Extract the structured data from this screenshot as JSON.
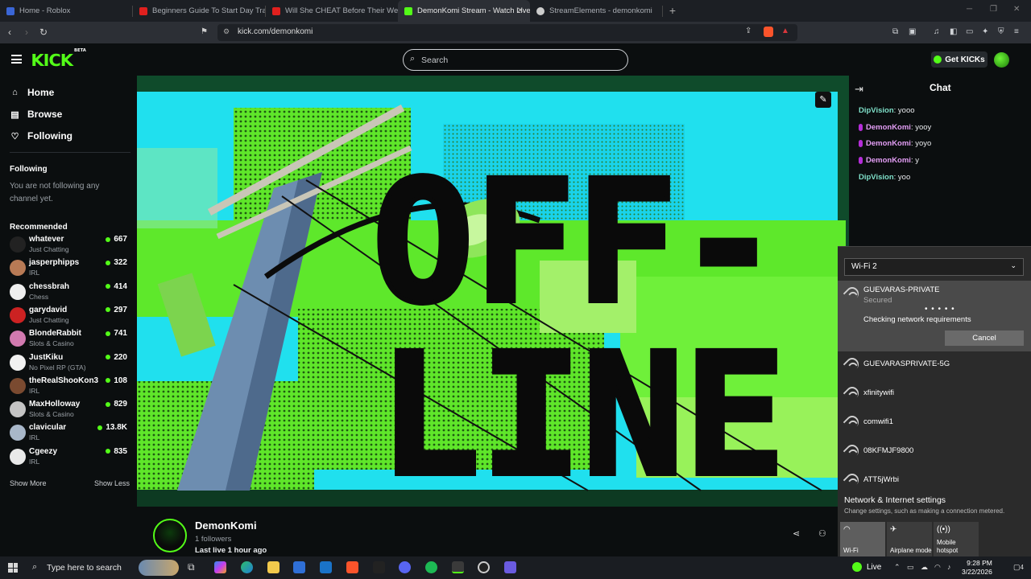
{
  "browser": {
    "tabs": [
      {
        "title": "Home - Roblox",
        "color": "#3a66d6"
      },
      {
        "title": "Beginners Guide To Start Day Trading",
        "color": "#e0201e"
      },
      {
        "title": "Will She CHEAT Before Their Wedding",
        "color": "#e0201e"
      },
      {
        "title": "DemonKomi Stream - Watch Live",
        "color": "#53fc18"
      },
      {
        "title": "StreamElements - demonkomi",
        "color": "#cccccc"
      }
    ],
    "active_tab_index": 3,
    "new_tab_symbol": "+",
    "url": "kick.com/demonkomi"
  },
  "kick": {
    "logo": "KICK",
    "logo_sup": "BETA",
    "search_placeholder": "Search",
    "get_kicks_label": "Get KICKs",
    "accent": "#53fc18"
  },
  "sidebar": {
    "nav": [
      {
        "label": "Home",
        "icon": "home-icon",
        "glyph": "⌂"
      },
      {
        "label": "Browse",
        "icon": "browse-icon",
        "glyph": "▤"
      },
      {
        "label": "Following",
        "icon": "heart-icon",
        "glyph": "♡"
      }
    ],
    "following_heading": "Following",
    "following_empty": "You are not following any channel yet.",
    "recommended_heading": "Recommended",
    "recommended": [
      {
        "name": "whatever",
        "category": "Just Chatting",
        "viewers": "667",
        "avatar": "#222222"
      },
      {
        "name": "jasperphipps",
        "category": "IRL",
        "viewers": "322",
        "avatar": "#b87a55"
      },
      {
        "name": "chessbrah",
        "category": "Chess",
        "viewers": "414",
        "avatar": "#eeeeee"
      },
      {
        "name": "garydavid",
        "category": "Just Chatting",
        "viewers": "297",
        "avatar": "#cc2222"
      },
      {
        "name": "BlondeRabbit",
        "category": "Slots & Casino",
        "viewers": "741",
        "avatar": "#d27ab0"
      },
      {
        "name": "JustKiku",
        "category": "No Pixel RP (GTA)",
        "viewers": "220",
        "avatar": "#f1f1f1"
      },
      {
        "name": "theRealShooKon3",
        "category": "IRL",
        "viewers": "108",
        "avatar": "#7a4a30"
      },
      {
        "name": "MaxHolloway",
        "category": "Slots & Casino",
        "viewers": "829",
        "avatar": "#c4c4c4"
      },
      {
        "name": "clavicular",
        "category": "IRL",
        "viewers": "13.8K",
        "avatar": "#a8b7c9"
      },
      {
        "name": "Cgeezy",
        "category": "IRL",
        "viewers": "835",
        "avatar": "#e9e9e9"
      }
    ],
    "show_more": "Show More",
    "show_less": "Show Less"
  },
  "video": {
    "offline_line1": "OFF-",
    "offline_line2": "LINE"
  },
  "channel": {
    "name": "DemonKomi",
    "followers": "1 followers",
    "last_live": "Last live 1 hour ago"
  },
  "chat": {
    "title": "Chat",
    "messages": [
      {
        "user": "DipVision",
        "text": "yooo",
        "color": "#7fe0c9",
        "badge": false
      },
      {
        "user": "DemonKomi",
        "text": "yooy",
        "color": "#e39ef5",
        "badge": true
      },
      {
        "user": "DemonKomi",
        "text": "yoyo",
        "color": "#e39ef5",
        "badge": true
      },
      {
        "user": "DemonKomi",
        "text": "y",
        "color": "#e39ef5",
        "badge": true
      },
      {
        "user": "DipVision",
        "text": "yoo",
        "color": "#7fe0c9",
        "badge": false
      }
    ]
  },
  "wifi": {
    "adapter": "Wi-Fi 2",
    "connecting": {
      "name": "GUEVARAS-PRIVATE",
      "status": "Secured",
      "progress": "• • • • •",
      "message": "Checking network requirements",
      "cancel": "Cancel"
    },
    "networks": [
      "GUEVARASPRIVATE-5G",
      "xfinitywifi",
      "comwifi1",
      "08KFMJF9800",
      "ATT5jWrbi"
    ],
    "settings_title": "Network & Internet settings",
    "settings_sub": "Change settings, such as making a connection metered.",
    "quick_actions": [
      {
        "label": "Wi-Fi",
        "icon": "wifi-icon",
        "active": true
      },
      {
        "label": "Airplane mode",
        "icon": "airplane-icon",
        "active": false
      },
      {
        "label": "Mobile hotspot",
        "icon": "hotspot-icon",
        "active": false
      }
    ]
  },
  "taskbar": {
    "search_placeholder": "Type here to search",
    "live_label": "Live",
    "time": "9:28 PM",
    "date": "3/22/2026",
    "notification_count": "4"
  }
}
